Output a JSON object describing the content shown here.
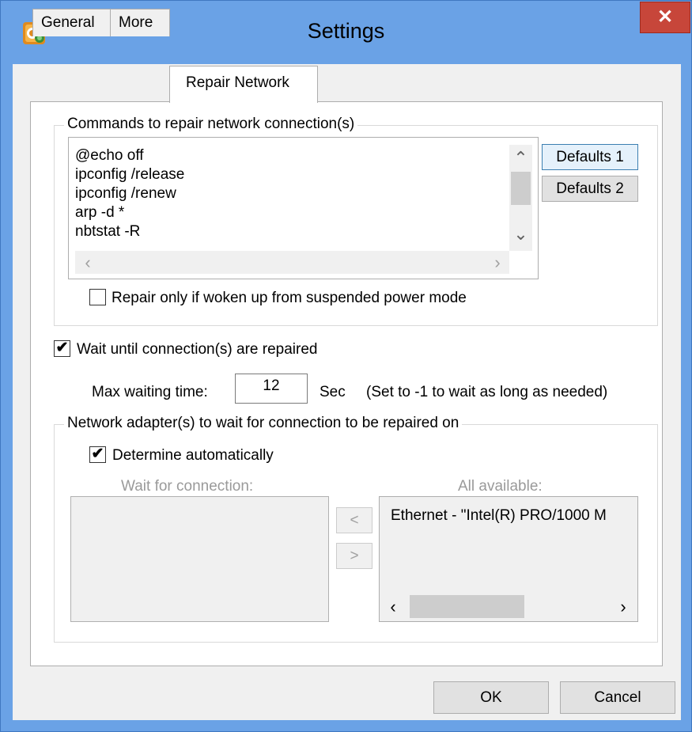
{
  "window": {
    "title": "Settings",
    "close_glyph": "✕"
  },
  "tabs": [
    {
      "label": "General"
    },
    {
      "label": "More"
    },
    {
      "label": "Repair Network"
    }
  ],
  "repair": {
    "group_label": "Commands to repair network connection(s)",
    "commands": [
      "@echo off",
      "ipconfig /release",
      "ipconfig /renew",
      "arp -d *",
      "nbtstat -R"
    ],
    "defaults1_label": "Defaults 1",
    "defaults2_label": "Defaults 2",
    "suspended_label": "Repair only if woken up from suspended power mode",
    "suspended_checked": false
  },
  "wait": {
    "label": "Wait until connection(s) are repaired",
    "checked": true,
    "max_label": "Max waiting time:",
    "max_value": "12",
    "sec_label": "Sec",
    "hint": "(Set to -1 to wait as long as needed)"
  },
  "adapters": {
    "group_label": "Network adapter(s) to wait for connection to be repaired on",
    "auto_label": "Determine automatically",
    "auto_checked": true,
    "wait_for_label": "Wait for connection:",
    "available_label": "All available:",
    "available_items": [
      "Ethernet - \"Intel(R) PRO/1000 M"
    ],
    "move_left": "<",
    "move_right": ">"
  },
  "footer": {
    "ok_label": "OK",
    "cancel_label": "Cancel"
  },
  "icons": {
    "check": "✔",
    "up": "⌃",
    "down": "⌄",
    "left": "‹",
    "right": "›"
  }
}
